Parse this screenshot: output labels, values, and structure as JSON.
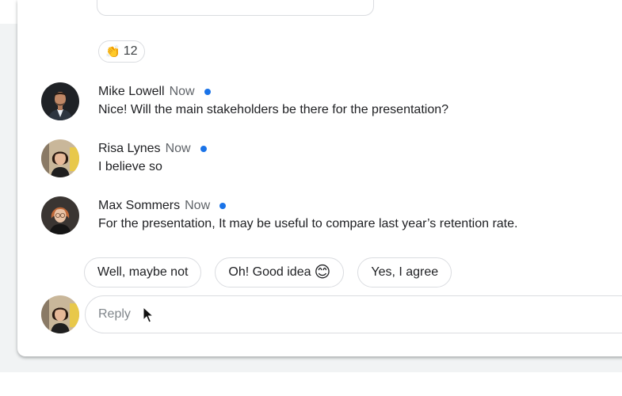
{
  "reaction": {
    "emoji": "👏",
    "count": "12"
  },
  "messages": [
    {
      "name": "Mike Lowell",
      "time": "Now",
      "text": "Nice! Will the main stakeholders be there for the presentation?"
    },
    {
      "name": "Risa Lynes",
      "time": "Now",
      "text": "I believe so"
    },
    {
      "name": "Max Sommers",
      "time": "Now",
      "text": "For the presentation, It may be useful to compare last year’s retention rate."
    }
  ],
  "smart_replies": [
    {
      "label": "Well, maybe not"
    },
    {
      "label": "Oh! Good idea",
      "emoji": "😊"
    },
    {
      "label": "Yes, I agree"
    }
  ],
  "reply_input": {
    "placeholder": "Reply"
  },
  "icons": {
    "unread_dot": "unread-dot-icon",
    "cursor": "mouse-pointer-icon"
  },
  "colors": {
    "unread_dot": "#1a73e8",
    "border": "#dadce0",
    "background": "#f1f3f4"
  }
}
